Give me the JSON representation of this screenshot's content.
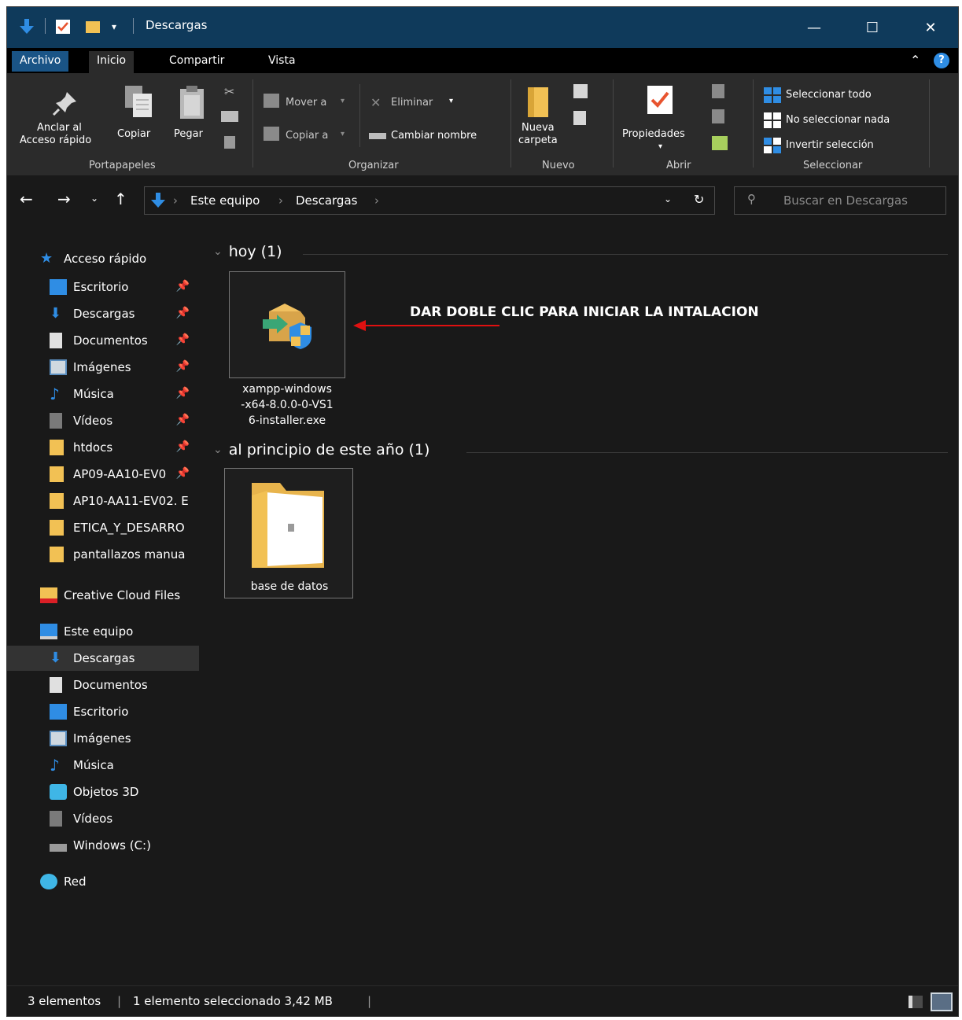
{
  "window": {
    "title": "Descargas"
  },
  "titlebar": {
    "minimize_glyph": "—",
    "maximize_glyph": "☐",
    "close_glyph": "✕"
  },
  "tabs": [
    "Archivo",
    "Inicio",
    "Compartir",
    "Vista"
  ],
  "ribbon": {
    "portapapeles": {
      "label": "Portapapeles",
      "anclar_line1": "Anclar al",
      "anclar_line2": "Acceso rápido",
      "copiar": "Copiar",
      "pegar": "Pegar"
    },
    "organizar": {
      "label": "Organizar",
      "mover": "Mover a",
      "copiar_a": "Copiar a",
      "eliminar": "Eliminar",
      "cambiar_nombre": "Cambiar nombre"
    },
    "nuevo": {
      "label": "Nuevo",
      "nueva_line1": "Nueva",
      "nueva_line2": "carpeta"
    },
    "abrir": {
      "label": "Abrir",
      "propiedades": "Propiedades"
    },
    "seleccionar": {
      "label": "Seleccionar",
      "todo": "Seleccionar todo",
      "nada": "No seleccionar nada",
      "invertir": "Invertir selección"
    }
  },
  "address": {
    "crumbs": [
      "Este equipo",
      "Descargas"
    ],
    "search_placeholder": "Buscar en Descargas"
  },
  "sidebar": {
    "quick_access": "Acceso rápido",
    "quick_items": [
      "Escritorio",
      "Descargas",
      "Documentos",
      "Imágenes",
      "Música",
      "Vídeos",
      "htdocs",
      "AP09-AA10-EV0",
      "AP10-AA11-EV02. E",
      "ETICA_Y_DESARRO",
      "pantallazos manua"
    ],
    "creative_cloud": "Creative Cloud Files",
    "this_pc": "Este equipo",
    "pc_items": [
      "Descargas",
      "Documentos",
      "Escritorio",
      "Imágenes",
      "Música",
      "Objetos 3D",
      "Vídeos",
      "Windows (C:)"
    ],
    "network": "Red"
  },
  "content": {
    "group_today": "hoy (1)",
    "group_year": "al principio de este año (1)",
    "file_installer": "xampp-windows-x64-8.0.0-0-VS16-installer.exe",
    "file_installer_lines": [
      "xampp-windows",
      "-x64-8.0.0-0-VS1",
      "6-installer.exe"
    ],
    "folder_db": "base de datos",
    "annotation": "DAR DOBLE CLIC PARA INICIAR LA INTALACION"
  },
  "status": {
    "count": "3 elementos",
    "selection": "1 elemento seleccionado  3,42 MB"
  },
  "colors": {
    "titlebar": "#0f3a5b",
    "accent": "#1a5486",
    "folder": "#f2c154",
    "arrow": "#e01010"
  }
}
